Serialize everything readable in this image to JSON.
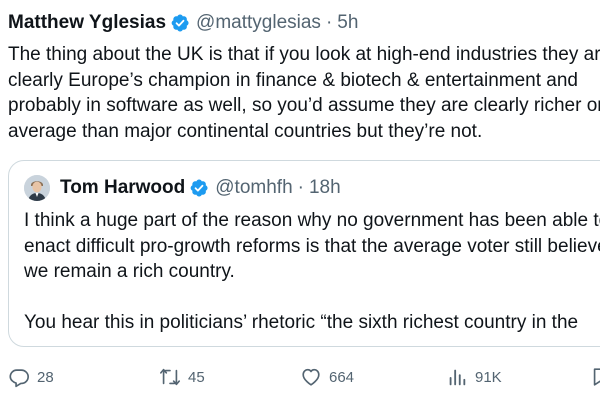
{
  "tweet": {
    "author_name": "Matthew Yglesias",
    "handle": "@mattyglesias",
    "separator": "·",
    "time": "5h",
    "text": "The thing about the UK is that if you look at high-end industries they are\nclearly Europe’s champion in finance & biotech & entertainment and\nprobably in software as well, so you’d assume they are clearly richer on\naverage than major continental countries but they’re not."
  },
  "quote": {
    "author_name": "Tom Harwood",
    "handle": "@tomhfh",
    "separator": "·",
    "time": "18h",
    "text": "I think a huge part of the reason why no government has been able to\nenact difficult pro-growth reforms is that the average voter still believes\nwe remain a rich country.\n\nYou hear this in politicians’ rhetoric “the sixth richest country in the"
  },
  "actions": {
    "replies": "28",
    "retweets": "45",
    "likes": "664",
    "views": "91K"
  },
  "colors": {
    "verified": "#1d9bf0",
    "muted": "#536471",
    "border": "#cfd9de",
    "text": "#0f1419"
  }
}
